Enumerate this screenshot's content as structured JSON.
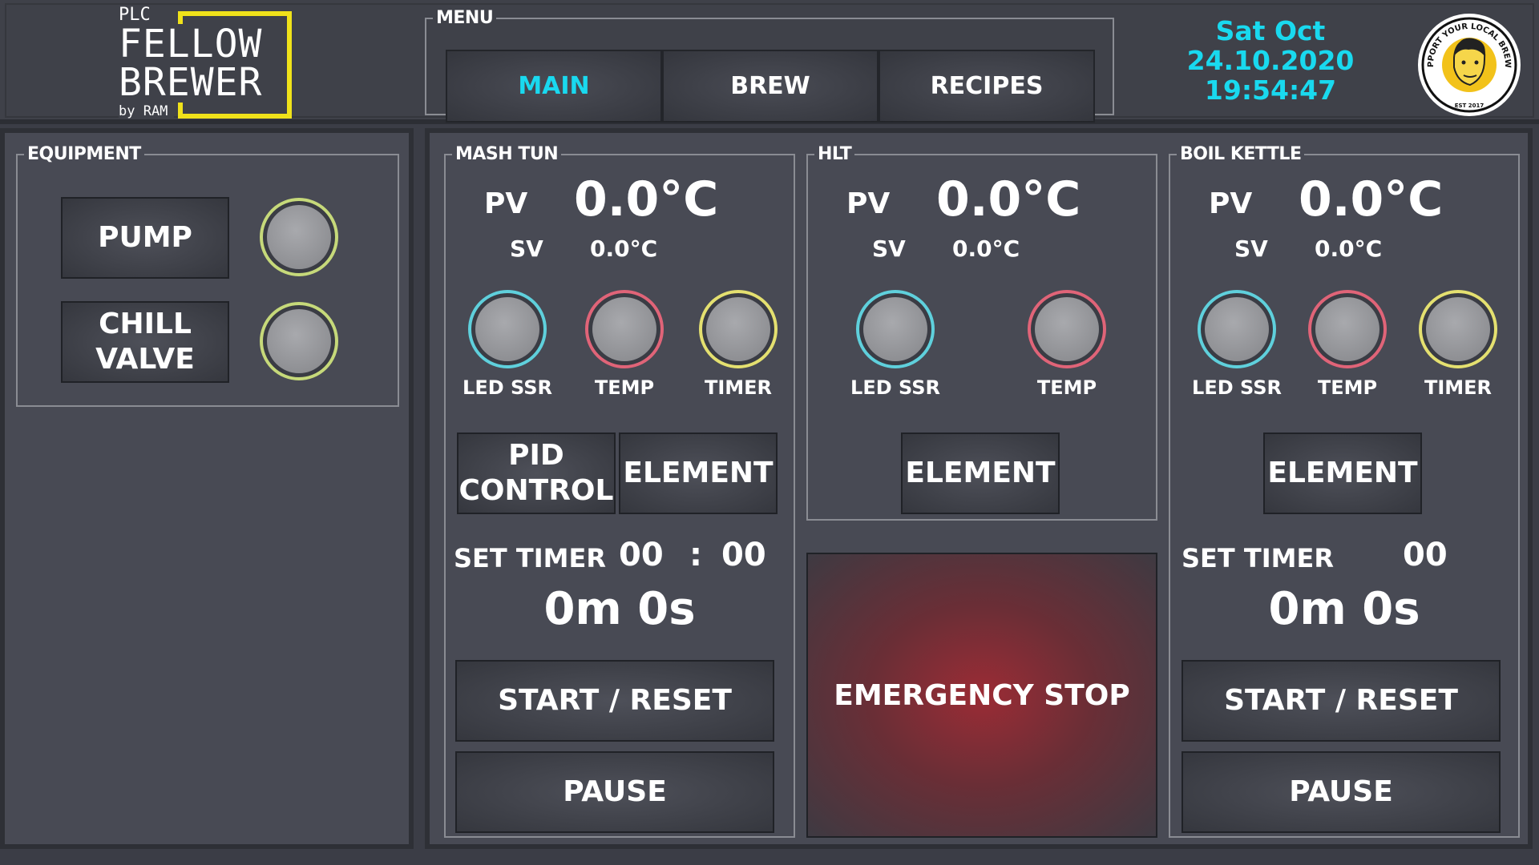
{
  "logo": {
    "plc": "PLC",
    "line1": "FELLOW",
    "line2": "BREWER",
    "byline": "by RAM",
    "badge_top": "SUPPORT YOUR LOCAL BREWER",
    "badge_est": "EST 2017"
  },
  "menu": {
    "legend": "MENU",
    "tabs": [
      {
        "label": "MAIN",
        "active": true
      },
      {
        "label": "BREW",
        "active": false
      },
      {
        "label": "RECIPES",
        "active": false
      }
    ]
  },
  "clock": {
    "day": "Sat Oct",
    "date": "24.10.2020",
    "time": "19:54:47"
  },
  "equipment": {
    "legend": "EQUIPMENT",
    "pump_label": "PUMP",
    "chill_label": "CHILL\nVALVE"
  },
  "mash_tun": {
    "legend": "MASH TUN",
    "pv_label": "PV",
    "pv_value": "0.0°C",
    "sv_label": "SV",
    "sv_value": "0.0°C",
    "indicators": [
      "LED SSR",
      "TEMP",
      "TIMER"
    ],
    "pid_label": "PID\nCONTROL",
    "element_label": "ELEMENT",
    "set_timer_label": "SET TIMER",
    "timer_min": "00",
    "timer_sep": ":",
    "timer_sec": "00",
    "elapsed": "0m 0s",
    "start_label": "START / RESET",
    "pause_label": "PAUSE"
  },
  "hlt": {
    "legend": "HLT",
    "pv_label": "PV",
    "pv_value": "0.0°C",
    "sv_label": "SV",
    "sv_value": "0.0°C",
    "indicators": [
      "LED SSR",
      "TEMP"
    ],
    "element_label": "ELEMENT"
  },
  "boil_kettle": {
    "legend": "BOIL KETTLE",
    "pv_label": "PV",
    "pv_value": "0.0°C",
    "sv_label": "SV",
    "sv_value": "0.0°C",
    "indicators": [
      "LED SSR",
      "TEMP",
      "TIMER"
    ],
    "element_label": "ELEMENT",
    "set_timer_label": "SET TIMER",
    "timer_min": "00",
    "elapsed": "0m 0s",
    "start_label": "START / RESET",
    "pause_label": "PAUSE"
  },
  "emergency": {
    "label": "EMERGENCY STOP"
  },
  "colors": {
    "accent_cyan": "#19d9ef",
    "logo_yellow": "#f0e21a",
    "ring_cyan": "#5fd0dc",
    "ring_red": "#e06478",
    "ring_yellow": "#e4e070",
    "ring_green": "#c6d97a",
    "estop": "#9b2c35"
  }
}
